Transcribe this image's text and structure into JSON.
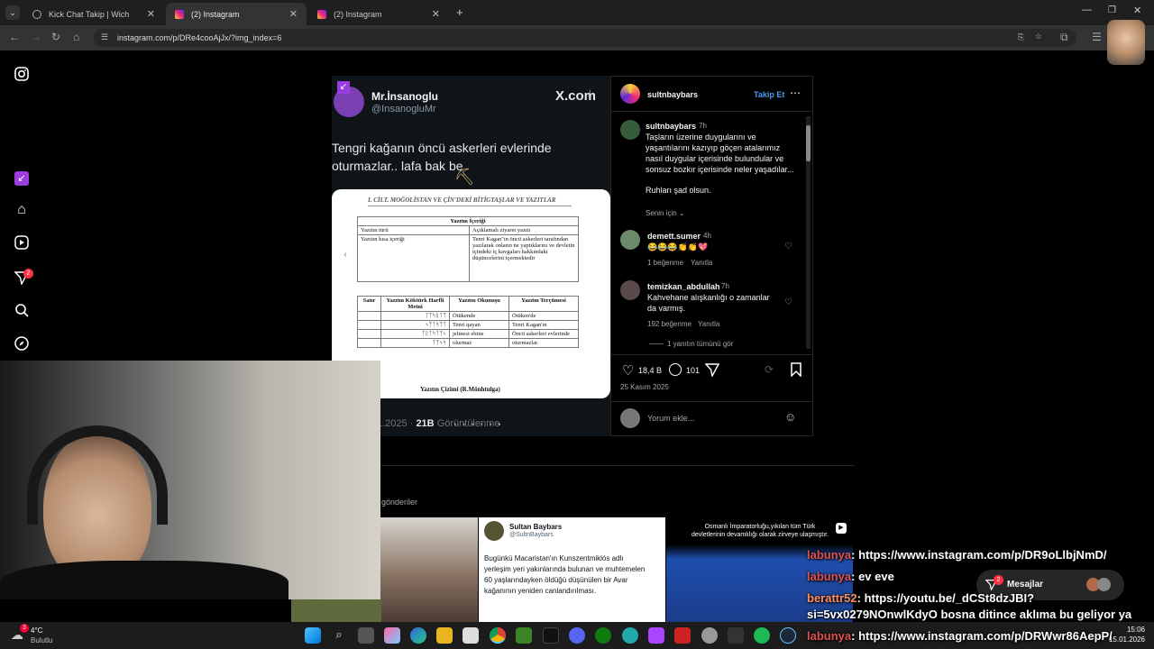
{
  "browser": {
    "tabs": [
      {
        "title": "Kick Chat Takip | Wich",
        "active": false
      },
      {
        "title": "(2) Instagram",
        "active": true
      },
      {
        "title": "(2) Instagram",
        "active": false
      }
    ],
    "url": "instagram.com/p/DRe4cooAjJx/?img_index=6"
  },
  "sidebar": {
    "notification_badge": "2"
  },
  "tweet": {
    "display_name": "Mr.İnsanoglu",
    "handle": "@InsanogluMr",
    "brand": "X.com",
    "text": "Tengri kağanın öncü askerleri evlerinde oturmazlar.. lafa bak be",
    "footer_date": "1.2025",
    "footer_views": "21B",
    "footer_views_label": "Görüntülenme"
  },
  "document": {
    "header": "I. CİLT. MOĞOLİSTAN VE ÇİN'DEKİ BİTİGTAŞLAR VE YAZITLAR",
    "content_title": "Yazıtın İçeriği",
    "type_label": "Yazıtın türü",
    "type_value": "Açıklamalı ziyaret yazıtı",
    "summary_label": "Yazıtın kısa içeriği",
    "summary_value": "Tenri Kagan\"ın öncü askerleri tarafından yazılarak onların ne yaptıklarını ve devletin içindeki iç kavgaları hakkındaki düşüncelerini içermektedir",
    "headers": [
      "Satır",
      "Yazıtın Köktürk Harfli Metni",
      "Yazıtın Okunuşu",
      "Yazıtın Terçümesi"
    ],
    "rows": [
      {
        "runic": "ᛏᛉᛋᚱᛏᛉ",
        "reading": "Ötükende",
        "translation": "Ötüken'de"
      },
      {
        "runic": "ᛃᛉᛏᛋᛉᛏ",
        "reading": "Tenri qayan",
        "translation": "Tenri Kagan'ın"
      },
      {
        "runic": "ᛏᚱᛏᛋᛏᛉᛃ",
        "reading": "jelmesi ebine",
        "translation": "Öncü askerleri evlerinde"
      },
      {
        "runic": "ᛏᛉᛃᛋ",
        "reading": "olurmaz",
        "translation": "oturmazlar."
      }
    ],
    "drawing_title": "Yazıtın Çizimi (R.Mönhtulga)"
  },
  "post": {
    "author": "sultnbaybars",
    "follow_label": "Takip Et",
    "caption_time": "7h",
    "caption": "Taşların üzerine duygularını ve yaşantılarını kazıyıp göçen atalarımız nasıl duygular içerisinde bulundular ve sonsuz bozkır içerisinde neler yaşadılar...",
    "caption_2": "Ruhları şad olsun.",
    "for_you_label": "Senin için",
    "comments": [
      {
        "user": "demett.sumer",
        "time": "4h",
        "text": "😂😂😂👏👏💖",
        "likes": "1 beğenme",
        "reply": "Yanıtla"
      },
      {
        "user": "temizkan_abdullah",
        "time": "7h",
        "text": "Kahvehane alışkanlığı o zamanlar da varmış.",
        "likes": "192 beğenme",
        "reply": "Yanıtla"
      }
    ],
    "view_replies": "1 yanıtın tümünü gör",
    "like_count": "18,4 B",
    "comment_count": "101",
    "date": "25 Kasım 2025",
    "add_comment_placeholder": "Yorum ekle..."
  },
  "related": {
    "label": "gönderiler",
    "card_tweet": {
      "name": "Sultan Baybars",
      "handle": "@SultnBaybars",
      "text": "Bugünkü Macaristan'ın Kunszentmiklós adlı yerleşim yeri yakınlarında bulunan ve muhtemelen 60 yaşlarındayken öldüğü düşünülen bir Avar kağanının yeniden canlandırılması."
    },
    "card_reel_title": "Osmanlı İmparatorluğu,yıkılan tüm Türk devletlerinin devamlılığı olarak zirveye ulaşmıştır."
  },
  "messages": {
    "label": "Mesajlar",
    "badge": "2"
  },
  "chat": [
    {
      "user": "labunya",
      "msg": "https://www.instagram.com/p/DR9oLlbjNmD/"
    },
    {
      "user": "labunya",
      "msg": "ev eve"
    },
    {
      "user": "berattr52",
      "msg": "https://youtu.be/_dCSt8dzJBI?"
    },
    {
      "user": "",
      "msg": "si=5vx0279NOnwlKdyO bosna ditince aklıma bu geliyor ya"
    },
    {
      "user": "labunya",
      "msg": "https://www.instagram.com/p/DRWwr86AepP/"
    }
  ],
  "taskbar": {
    "weather_temp": "4°C",
    "weather_label": "Bulutlu",
    "weather_badge": "3",
    "time": "15:06",
    "date": "15.01.2026"
  }
}
